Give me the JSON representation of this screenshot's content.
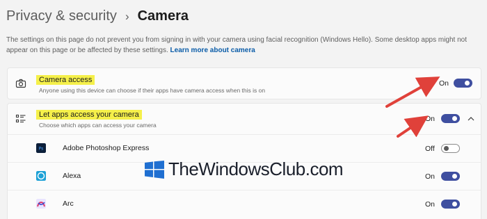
{
  "breadcrumb": {
    "parent": "Privacy & security",
    "separator": "›",
    "current": "Camera"
  },
  "description": {
    "text": "The settings on this page do not prevent you from signing in with your camera using facial recognition (Windows Hello). Some desktop apps might not appear on this page or be affected by these settings.",
    "link": "Learn more about camera"
  },
  "camera_access": {
    "title": "Camera access",
    "subtitle": "Anyone using this device can choose if their apps have camera access when this is on",
    "state": "On",
    "enabled": true,
    "icon": "camera-icon"
  },
  "apps_access": {
    "title": "Let apps access your camera",
    "subtitle": "Choose which apps can access your camera",
    "state": "On",
    "enabled": true,
    "expanded": true,
    "icon": "app-list-icon"
  },
  "apps": [
    {
      "name": "Adobe Photoshop Express",
      "state": "Off",
      "enabled": false,
      "icon": "photoshop-express-icon"
    },
    {
      "name": "Alexa",
      "state": "On",
      "enabled": true,
      "icon": "alexa-icon"
    },
    {
      "name": "Arc",
      "state": "On",
      "enabled": true,
      "icon": "arc-icon"
    }
  ],
  "watermark": {
    "text": "TheWindowsClub.com"
  },
  "colors": {
    "toggle_on": "#3f4fa0",
    "highlight": "#f5f04a",
    "arrow": "#e0413a"
  }
}
